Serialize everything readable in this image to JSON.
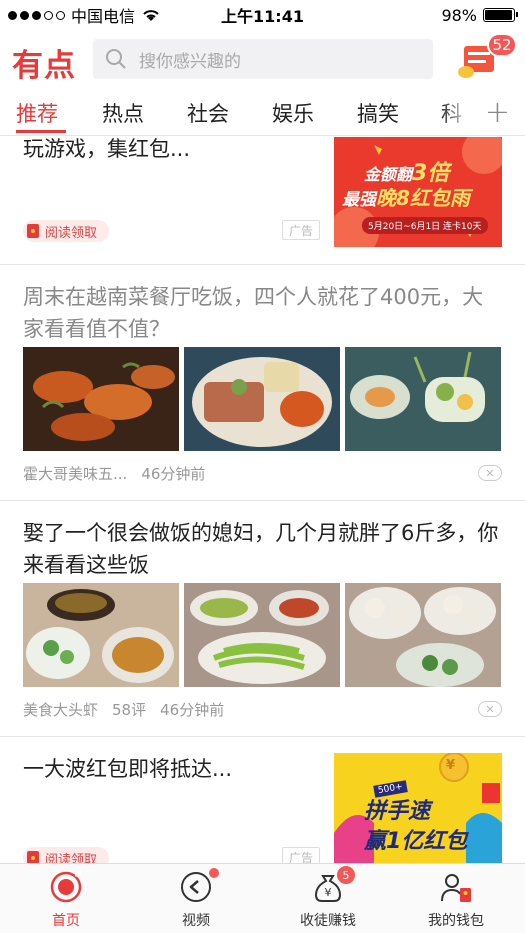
{
  "status": {
    "carrier": "中国电信",
    "time": "上午11:41",
    "battery": "98%",
    "battery_level": 0.98
  },
  "header": {
    "logo": "有点",
    "search_placeholder": "搜你感兴趣的",
    "gift_badge": "52"
  },
  "tabs": [
    "推荐",
    "热点",
    "社会",
    "娱乐",
    "搞笑",
    "科"
  ],
  "tabs_plus": "+",
  "feed": [
    {
      "title": "玩游戏，集红包...",
      "tag": "阅读领取",
      "ad_label": "广告",
      "banner": {
        "line1": "金额翻",
        "big": "3倍",
        "line2": "最强",
        "line3": "晚8红包雨",
        "date": "5月20日~6月1日  连卡10天"
      }
    },
    {
      "title": "周末在越南菜餐厅吃饭，四个人就花了400元，大家看看值不值？",
      "source": "霍大哥美味五...",
      "time": "46分钟前"
    },
    {
      "title": "娶了一个很会做饭的媳妇，几个月就胖了6斤多，你来看看这些饭",
      "source": "美食大头虾",
      "comments": "58评",
      "time": "46分钟前"
    },
    {
      "title": "一大波红包即将抵达...",
      "tag": "阅读领取",
      "ad_label": "广告",
      "banner": {
        "line1": "拼手速",
        "line2": "赢1亿红包",
        "coin": "¥",
        "sub": "500+"
      }
    }
  ],
  "tabbar": [
    {
      "label": "首页",
      "icon": "home-icon"
    },
    {
      "label": "视频",
      "icon": "play-icon"
    },
    {
      "label": "收徒赚钱",
      "icon": "money-bag-icon",
      "badge": "5"
    },
    {
      "label": "我的钱包",
      "icon": "wallet-user-icon"
    }
  ],
  "colors": {
    "brand": "#e83a3a",
    "badge": "#f55757"
  }
}
